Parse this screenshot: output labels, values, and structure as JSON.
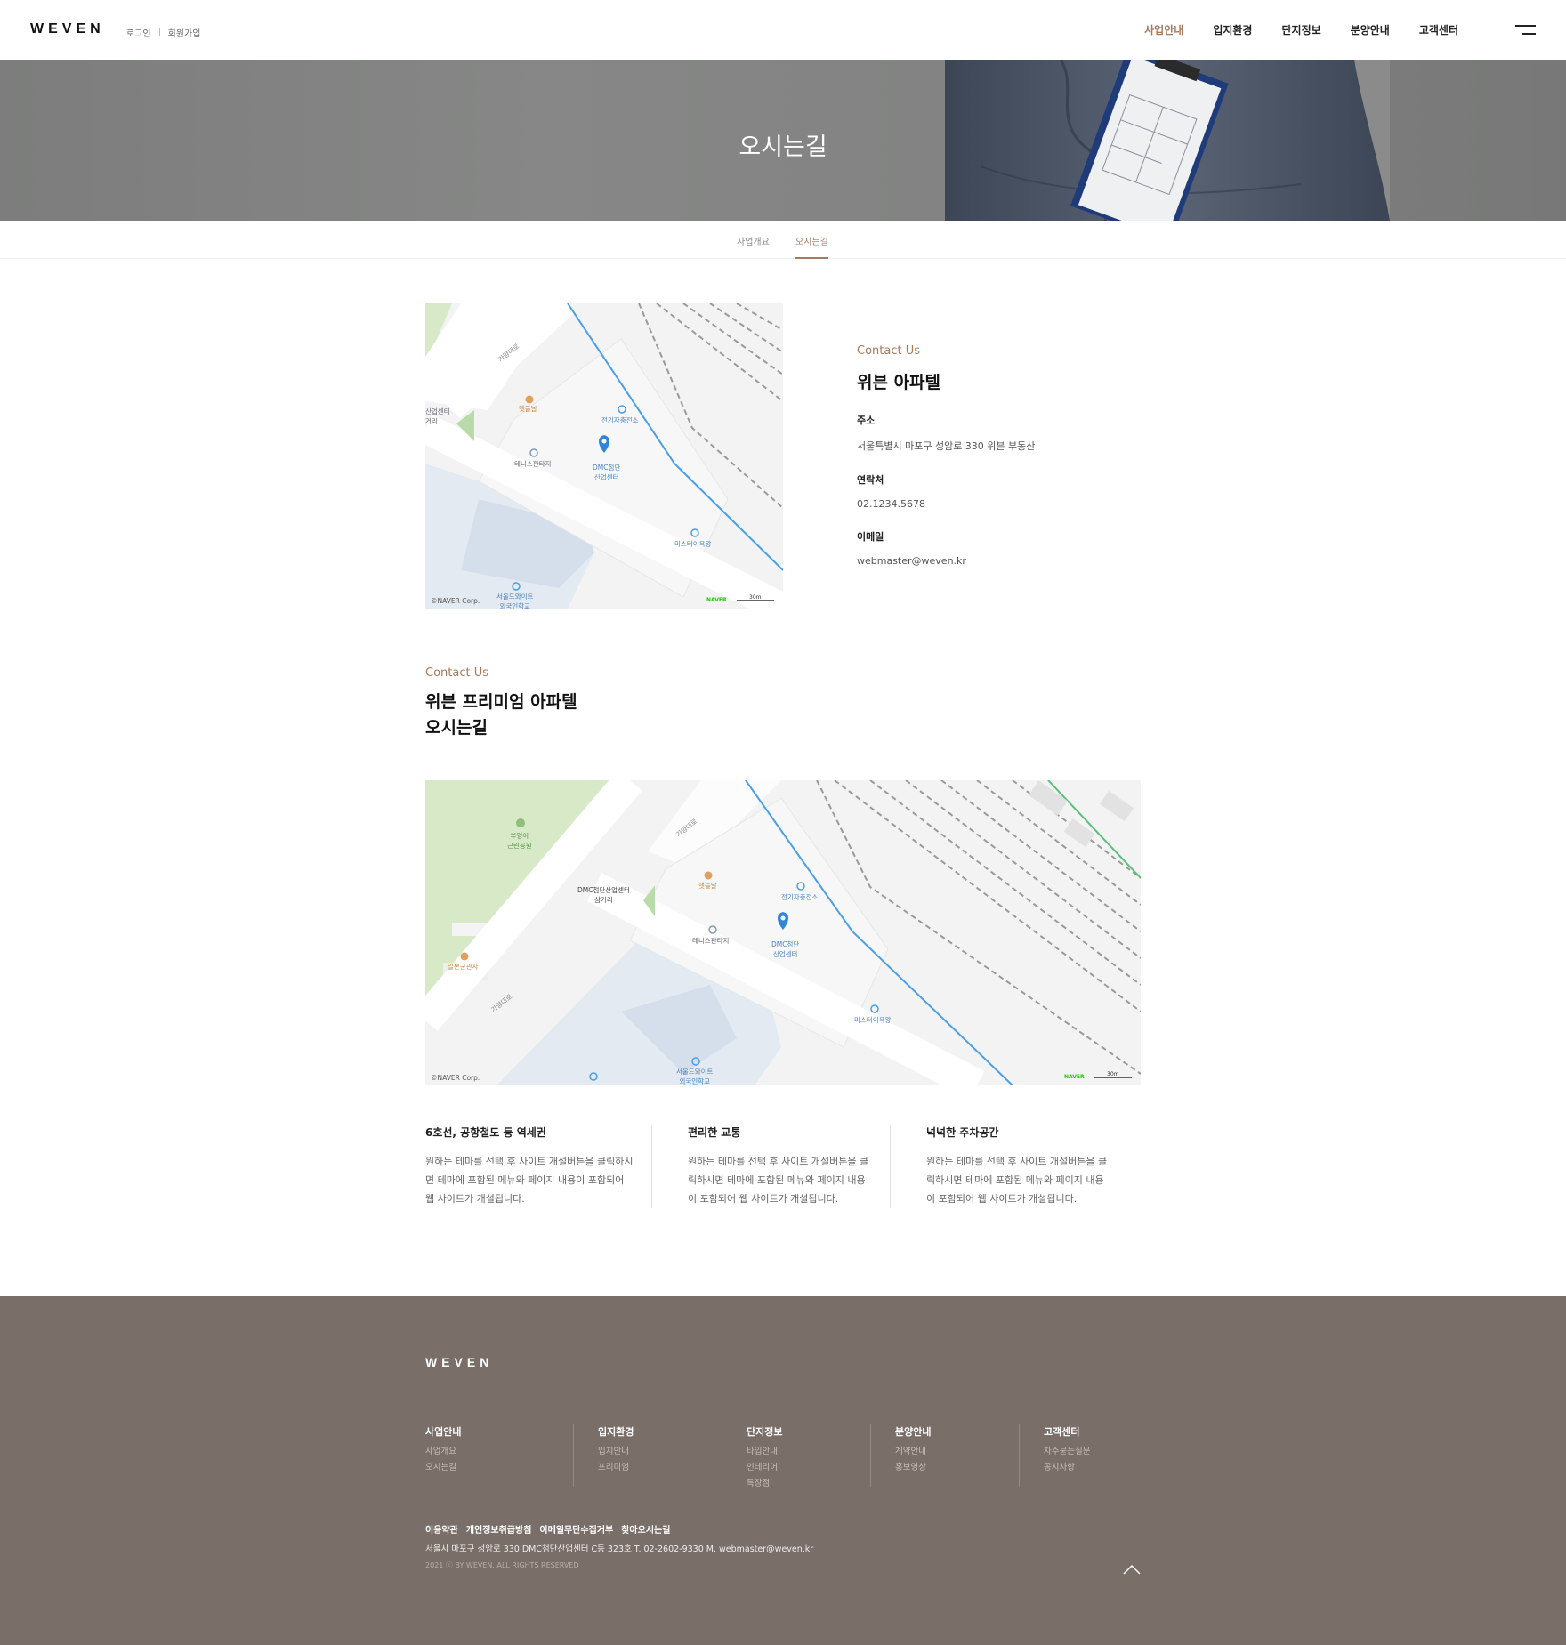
{
  "header": {
    "logo": "WEVEN",
    "login": "로그인",
    "join": "회원가입",
    "nav": [
      "사업안내",
      "입지환경",
      "단지정보",
      "분양안내",
      "고객센터"
    ],
    "active_nav_index": 0
  },
  "hero": {
    "title": "오시는길"
  },
  "subtabs": [
    "사업개요",
    "오시는길"
  ],
  "map_small": {
    "labels": {
      "road1": "가양대로",
      "poi1": "햇뜰날",
      "poi2": "전기자충전소",
      "poi3": "테니스판타지",
      "marker": "DMC첨단\n산업센터",
      "poi4": "미스터이욕왕",
      "poi5": "서울드와이트\n외국인학교",
      "side": "산업센터\n거리",
      "credit": "©NAVER Corp.",
      "naver": "NAVER",
      "scale": "30m"
    }
  },
  "contact": {
    "eyebrow": "Contact Us",
    "title": "위븐 아파텔",
    "address_label": "주소",
    "address": "서울특별시 마포구 성암로 330 위븐 부동산",
    "phone_label": "연락처",
    "phone": "02.1234.5678",
    "email_label": "이메일",
    "email": "webmaster@weven.kr"
  },
  "section2": {
    "eyebrow": "Contact Us",
    "title_line1": "위븐 프리미엄 아파텔",
    "title_line2": "오시는길"
  },
  "map_large": {
    "labels": {
      "park": "부엉이\n근린공원",
      "road1": "가양대로",
      "road2": "가양대로",
      "junction": "DMC첨단산업센터\n삼거리",
      "poi1": "햇뜰날",
      "poi2": "전기자충전소",
      "poi3": "테니스판타지",
      "marker": "DMC첨단\n산업센터",
      "poi4": "미스터이욕왕",
      "poi5": "서울드와이트\n외국인학교",
      "poi6": "일본군관사",
      "credit": "©NAVER Corp.",
      "naver": "NAVER",
      "scale": "30m"
    }
  },
  "features": [
    {
      "title": "6호선, 공항철도 등 역세권",
      "text": "원하는 테마를 선택 후 사이트 개설버튼을 클릭하시면 테마에 포함된 메뉴와 페이지 내용이 포함되어 웹 사이트가 개설됩니다."
    },
    {
      "title": "편리한 교통",
      "text": "원하는 테마를 선택 후 사이트 개설버튼을 클릭하시면 테마에 포함된 메뉴와 페이지 내용이 포함되어 웹 사이트가 개설됩니다."
    },
    {
      "title": "넉넉한 주차공간",
      "text": "원하는 테마를 선택 후 사이트 개설버튼을 클릭하시면 테마에 포함된 메뉴와 페이지 내용이 포함되어 웹 사이트가 개설됩니다."
    }
  ],
  "footer": {
    "logo": "WEVEN",
    "columns": [
      {
        "title": "사업안내",
        "items": [
          "사업개요",
          "오시는길"
        ]
      },
      {
        "title": "입지환경",
        "items": [
          "입지안내",
          "프리미엄"
        ]
      },
      {
        "title": "단지정보",
        "items": [
          "타입안내",
          "인테리어",
          "특장점"
        ]
      },
      {
        "title": "분양안내",
        "items": [
          "계약안내",
          "홍보영상"
        ]
      },
      {
        "title": "고객센터",
        "items": [
          "자주묻는질문",
          "공지사항"
        ]
      }
    ],
    "links": [
      "이용약관",
      "개인정보취급방침",
      "이메일무단수집거부",
      "찾아오시는길"
    ],
    "address": "서울시 마포구 성암로 330 DMC첨단산업센터 C동 323호   T. 02-2602-9330   M. webmaster@weven.kr",
    "copyright": "2021 ⓒ BY WEVEN. ALL RIGHTS RESERVED"
  },
  "colors": {
    "accent": "#a67a5b",
    "footer_bg": "#7a6e69",
    "map_route": "#4a9fe6",
    "park": "#d8e9c8",
    "water": "#e3eaf2"
  }
}
